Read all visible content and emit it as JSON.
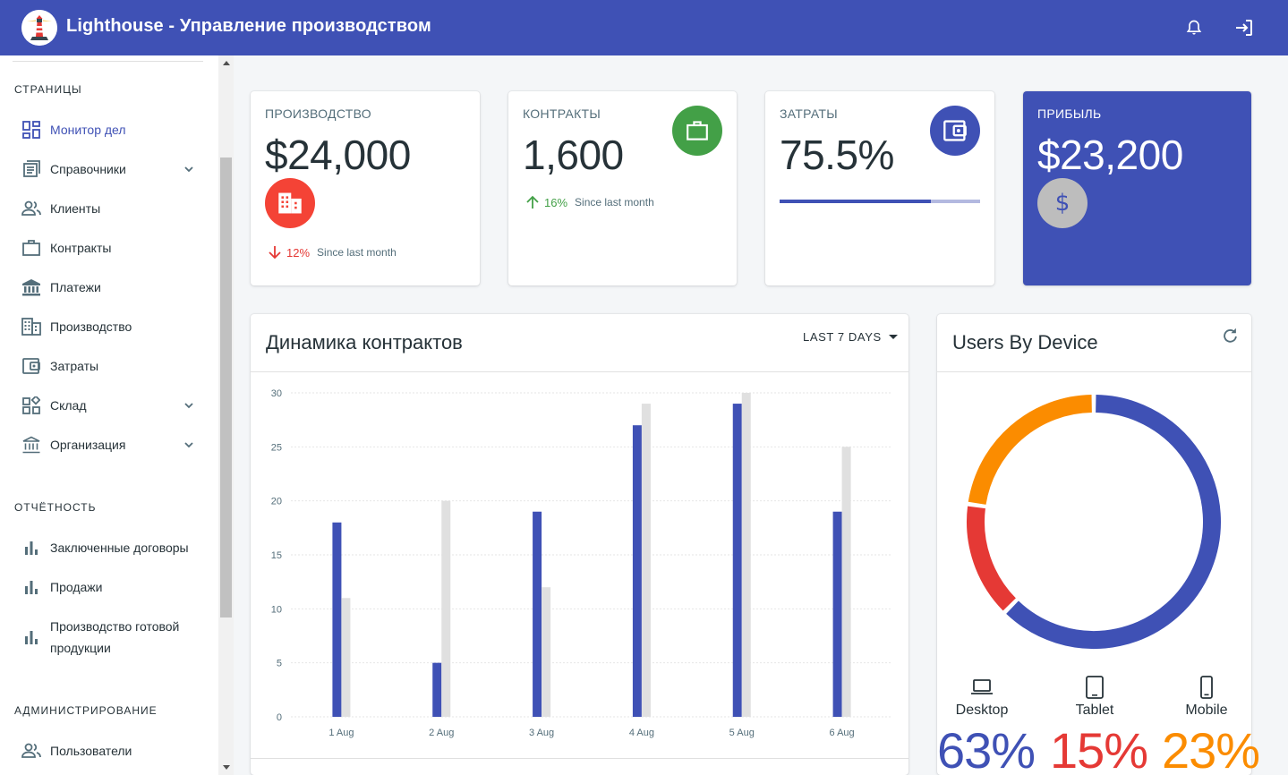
{
  "app": {
    "title": "Lighthouse - Управление производством"
  },
  "sidebar": {
    "section_pages": "СТРАНИЦЫ",
    "section_reports": "ОТЧЁТНОСТЬ",
    "section_admin": "АДМИНИСТРИРОВАНИЕ",
    "items": [
      {
        "label": "Монитор дел",
        "icon": "dashboard-icon",
        "active": true
      },
      {
        "label": "Справочники",
        "icon": "list-alt-icon",
        "expandable": true
      },
      {
        "label": "Клиенты",
        "icon": "people-icon"
      },
      {
        "label": "Контракты",
        "icon": "briefcase-icon"
      },
      {
        "label": "Платежи",
        "icon": "bank-icon"
      },
      {
        "label": "Производство",
        "icon": "building-icon"
      },
      {
        "label": "Затраты",
        "icon": "wallet-icon"
      },
      {
        "label": "Склад",
        "icon": "widgets-icon",
        "expandable": true
      },
      {
        "label": "Организация",
        "icon": "institution-icon",
        "expandable": true
      }
    ],
    "reports": [
      {
        "label": "Заключенные договоры",
        "icon": "bar-chart-icon"
      },
      {
        "label": "Продажи",
        "icon": "bar-chart-icon"
      },
      {
        "label": "Производство готовой продукции",
        "icon": "bar-chart-icon"
      }
    ],
    "admin": [
      {
        "label": "Пользователи",
        "icon": "people-icon"
      }
    ]
  },
  "kpis": {
    "production": {
      "title": "ПРОИЗВОДСТВО",
      "value": "$24,000",
      "diff": "12%",
      "caption": "Since last month",
      "trend": "down",
      "color": "#e53935"
    },
    "contracts": {
      "title": "КОНТРАКТЫ",
      "value": "1,600",
      "diff": "16%",
      "caption": "Since last month",
      "trend": "up",
      "color": "#43a047"
    },
    "costs": {
      "title": "ЗАТРАТЫ",
      "value": "75.5%",
      "progress": 0.755,
      "color": "#3f51b5"
    },
    "profit": {
      "title": "ПРИБЫЛЬ",
      "value": "$23,200",
      "color": "#3f51b5"
    }
  },
  "contracts_chart": {
    "title": "Динамика контрактов",
    "range_label": "LAST 7 DAYS"
  },
  "devices_card": {
    "title": "Users By Device",
    "items": [
      {
        "name": "Desktop",
        "value": "63%",
        "color": "#3f51b5",
        "icon": "laptop-icon"
      },
      {
        "name": "Tablet",
        "value": "15%",
        "color": "#e53935",
        "icon": "tablet-icon"
      },
      {
        "name": "Mobile",
        "value": "23%",
        "color": "#fb8c00",
        "icon": "phone-icon"
      }
    ]
  },
  "chart_data": [
    {
      "type": "bar",
      "categories": [
        "1 Aug",
        "2 Aug",
        "3 Aug",
        "4 Aug",
        "5 Aug",
        "6 Aug"
      ],
      "series": [
        {
          "values": [
            18,
            5,
            19,
            27,
            29,
            19
          ],
          "color": "#3f51b5"
        },
        {
          "values": [
            11,
            20,
            12,
            29,
            30,
            25
          ],
          "color": "#e0e0e0"
        }
      ],
      "ylim": [
        0,
        30
      ],
      "yticks": [
        0,
        5,
        10,
        15,
        20,
        25,
        30
      ],
      "grid": true
    },
    {
      "type": "pie",
      "categories": [
        "Desktop",
        "Tablet",
        "Mobile"
      ],
      "values": [
        63,
        15,
        23
      ],
      "colors": [
        "#3f51b5",
        "#e53935",
        "#fb8c00"
      ]
    }
  ]
}
